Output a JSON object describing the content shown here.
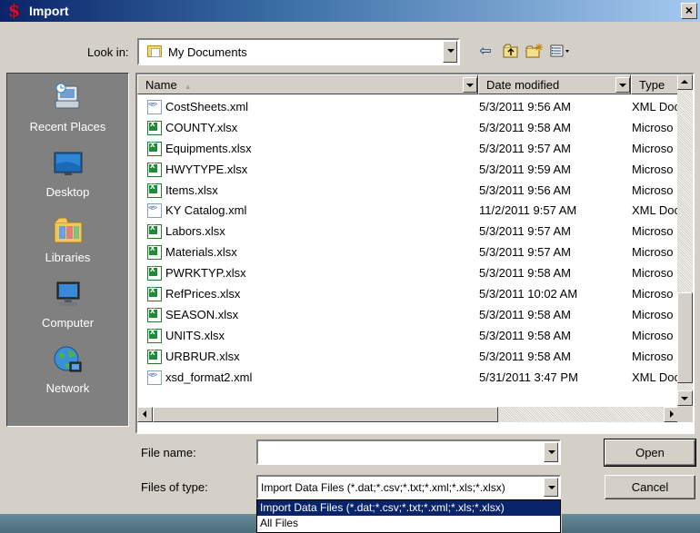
{
  "window": {
    "title": "Import",
    "close_glyph": "×",
    "app_glyph": "$"
  },
  "lookin": {
    "label": "Look in:",
    "value": "My Documents"
  },
  "places": [
    {
      "label": "Recent Places"
    },
    {
      "label": "Desktop"
    },
    {
      "label": "Libraries"
    },
    {
      "label": "Computer"
    },
    {
      "label": "Network"
    }
  ],
  "columns": {
    "name": "Name",
    "date": "Date modified",
    "type": "Type"
  },
  "files": [
    {
      "name": "CostSheets.xml",
      "date": "5/3/2011 9:56 AM",
      "type": "XML Doc",
      "icon": "xml"
    },
    {
      "name": "COUNTY.xlsx",
      "date": "5/3/2011 9:58 AM",
      "type": "Microso",
      "icon": "xlsx"
    },
    {
      "name": "Equipments.xlsx",
      "date": "5/3/2011 9:57 AM",
      "type": "Microso",
      "icon": "xlsx"
    },
    {
      "name": "HWYTYPE.xlsx",
      "date": "5/3/2011 9:59 AM",
      "type": "Microso",
      "icon": "xlsx"
    },
    {
      "name": "Items.xlsx",
      "date": "5/3/2011 9:56 AM",
      "type": "Microso",
      "icon": "xlsx"
    },
    {
      "name": "KY Catalog.xml",
      "date": "11/2/2011 9:57 AM",
      "type": "XML Doc",
      "icon": "xml"
    },
    {
      "name": "Labors.xlsx",
      "date": "5/3/2011 9:57 AM",
      "type": "Microso",
      "icon": "xlsx"
    },
    {
      "name": "Materials.xlsx",
      "date": "5/3/2011 9:57 AM",
      "type": "Microso",
      "icon": "xlsx"
    },
    {
      "name": "PWRKTYP.xlsx",
      "date": "5/3/2011 9:58 AM",
      "type": "Microso",
      "icon": "xlsx"
    },
    {
      "name": "RefPrices.xlsx",
      "date": "5/3/2011 10:02 AM",
      "type": "Microso",
      "icon": "xlsx"
    },
    {
      "name": "SEASON.xlsx",
      "date": "5/3/2011 9:58 AM",
      "type": "Microso",
      "icon": "xlsx"
    },
    {
      "name": "UNITS.xlsx",
      "date": "5/3/2011 9:58 AM",
      "type": "Microso",
      "icon": "xlsx"
    },
    {
      "name": "URBRUR.xlsx",
      "date": "5/3/2011 9:58 AM",
      "type": "Microso",
      "icon": "xlsx"
    },
    {
      "name": "xsd_format2.xml",
      "date": "5/31/2011 3:47 PM",
      "type": "XML Doc",
      "icon": "xml"
    }
  ],
  "filename": {
    "label": "File name:",
    "value": ""
  },
  "filetype": {
    "label": "Files of type:",
    "value": "Import Data Files (*.dat;*.csv;*.txt;*.xml;*.xls;*.xlsx)",
    "options": [
      "Import Data Files (*.dat;*.csv;*.txt;*.xml;*.xls;*.xlsx)",
      "All Files"
    ]
  },
  "buttons": {
    "open": "Open",
    "cancel": "Cancel"
  },
  "toolbar": {
    "back_glyph": "⇦",
    "up_glyph": "⮥",
    "new_folder_glyph": "✱",
    "views_glyph": "▦▾"
  }
}
